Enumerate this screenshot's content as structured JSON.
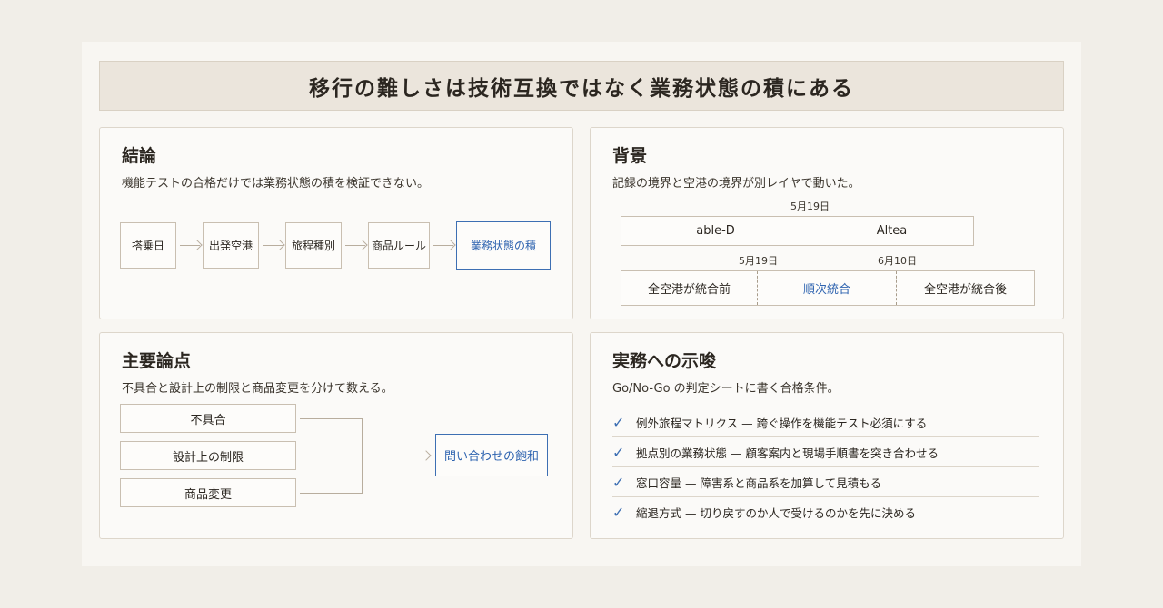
{
  "title": "移行の難しさは技術互換ではなく業務状態の積にある",
  "conclusion": {
    "heading": "結論",
    "lead": "機能テストの合格だけでは業務状態の積を検証できない。",
    "flow": [
      "搭乗日",
      "出発空港",
      "旅程種別",
      "商品ルール",
      "業務状態の積"
    ]
  },
  "background": {
    "heading": "背景",
    "lead": "記録の境界と空港の境界が別レイヤで動いた。",
    "record_date": "5月19日",
    "record_segments": [
      "able-D",
      "Altea"
    ],
    "airport_dates": [
      "5月19日",
      "6月10日"
    ],
    "airport_segments": [
      "全空港が統合前",
      "順次統合",
      "全空港が統合後"
    ]
  },
  "points": {
    "heading": "主要論点",
    "lead": "不具合と設計上の制限と商品変更を分けて数える。",
    "sources": [
      "不具合",
      "設計上の制限",
      "商品変更"
    ],
    "target": "問い合わせの飽和"
  },
  "implications": {
    "heading": "実務への示唆",
    "lead": "Go/No-Go の判定シートに書く合格条件。",
    "items": [
      "例外旅程マトリクス — 跨ぐ操作を機能テスト必須にする",
      "拠点別の業務状態 — 顧客案内と現場手順書を突き合わせる",
      "窓口容量 — 障害系と商品系を加算して見積もる",
      "縮退方式 — 切り戻すのか人で受けるのかを先に決める"
    ]
  }
}
